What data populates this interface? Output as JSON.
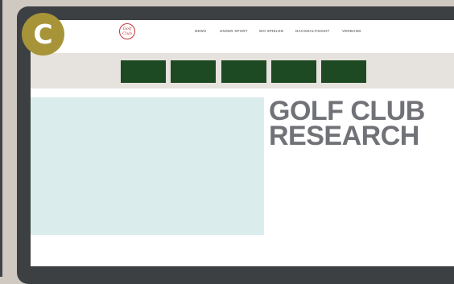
{
  "badge": {
    "letter": "C"
  },
  "site": {
    "logo_text_top": "Golf",
    "logo_text_bottom": "Club",
    "nav": [
      "NEWS",
      "UNSER SPORT",
      "WO SPIELEN",
      "NACHHALTIGKEIT",
      "VERBAND"
    ]
  },
  "hero": {
    "line1": "GOLF CLUB",
    "line2": "RESEARCH"
  },
  "colors": {
    "tile_green": "#1e4a23",
    "headline_gray": "#707277",
    "badge_gold": "#a89438",
    "logo_red": "#c4333a"
  }
}
